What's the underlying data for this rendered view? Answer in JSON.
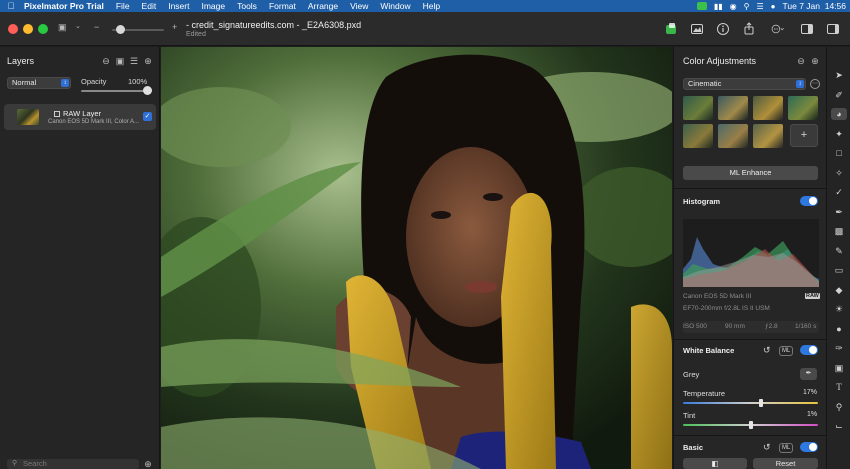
{
  "menubar": {
    "app_name": "Pixelmator Pro Trial",
    "items": [
      "File",
      "Edit",
      "Insert",
      "Image",
      "Tools",
      "Format",
      "Arrange",
      "View",
      "Window",
      "Help"
    ],
    "clock": "Tue 7 Jan  14:56"
  },
  "toolbar": {
    "title": "- credit_signatureedits.com - _E2A6308.pxd",
    "subtitle": "Edited",
    "zoom_minus": "−",
    "zoom_plus": "+"
  },
  "layers": {
    "title": "Layers",
    "blend_mode": "Normal",
    "opacity_label": "Opacity",
    "opacity_value": "100%",
    "opacity_fraction": 1.0,
    "layer": {
      "name": "RAW Layer",
      "meta": "Canon EOS 5D Mark III, Color A..."
    },
    "search_placeholder": "Search"
  },
  "adjust": {
    "title": "Color Adjustments",
    "preset": "Cinematic",
    "ml_enhance": "ML Enhance",
    "histogram": {
      "title": "Histogram",
      "camera": "Canon EOS 5D Mark III",
      "raw_badge": "RAW",
      "lens": "EF70-200mm f/2.8L IS II USM",
      "iso": "ISO 500",
      "focal": "90 mm",
      "aperture": "ƒ2.8",
      "shutter": "1/160 s"
    },
    "white_balance": {
      "title": "White Balance",
      "ml": "ML",
      "mode": "Grey",
      "temperature_label": "Temperature",
      "temperature_value": "17%",
      "tint_label": "Tint",
      "tint_value": "1%"
    },
    "basic": {
      "title": "Basic",
      "ml": "ML"
    },
    "compare": "◧",
    "reset": "Reset"
  },
  "colors": {
    "menubar": "#1f5fa8",
    "accent": "#2f78e0",
    "traffic_red": "#ff5f57",
    "traffic_yellow": "#febc2e",
    "traffic_green": "#28c840"
  },
  "icons": {
    "tools": [
      "arrange-icon",
      "style-icon",
      "color-adjust-icon",
      "effects-icon",
      "crop-select-icon",
      "magic-wand-icon",
      "color-picker-icon",
      "paint-icon",
      "bucket-icon",
      "retouch-icon",
      "eraser-icon",
      "sharpen-icon",
      "burn-icon",
      "sponge-icon",
      "pen-icon",
      "shape-icon",
      "type-icon",
      "zoom-icon",
      "crop-icon"
    ]
  }
}
